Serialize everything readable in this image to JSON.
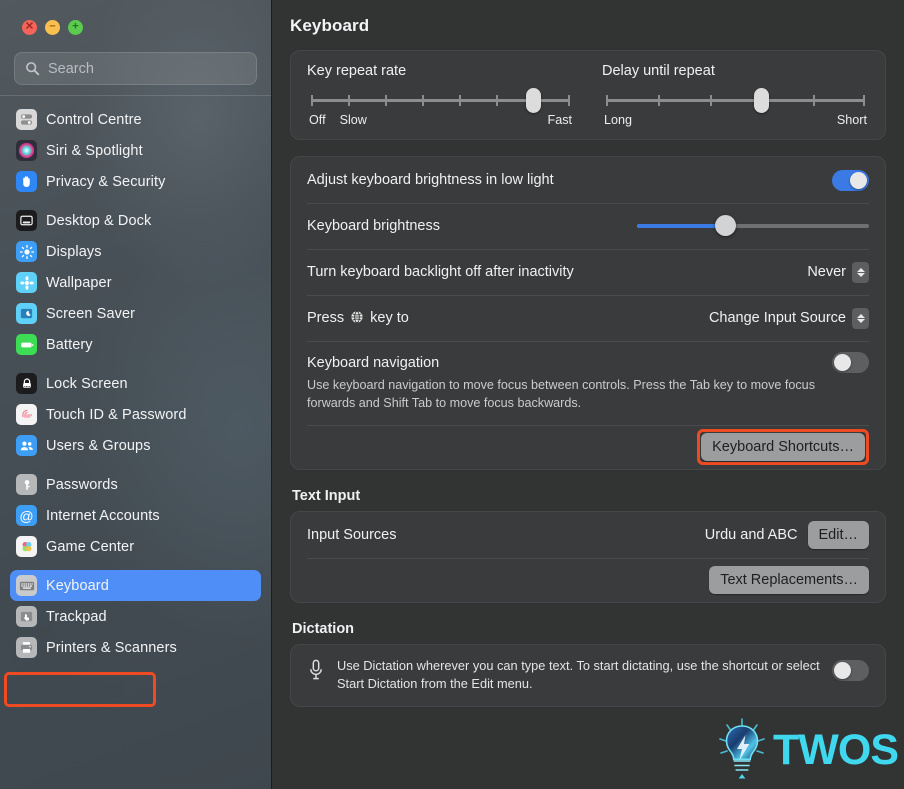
{
  "window": {
    "traffic_lights": [
      {
        "name": "close",
        "glyph": "×",
        "color": "#f4645b"
      },
      {
        "name": "minimize",
        "glyph": "−",
        "color": "#f9bf4f"
      },
      {
        "name": "maximize",
        "glyph": "+",
        "color": "#5cc94f"
      }
    ]
  },
  "sidebar": {
    "search": {
      "placeholder": "Search",
      "value": "",
      "icon": "search-icon"
    },
    "groups": [
      {
        "items": [
          {
            "label": "Control Centre",
            "icon": "control-centre-icon",
            "icon_bg": "#d8d8d8",
            "selected": false
          },
          {
            "label": "Siri & Spotlight",
            "icon": "siri-icon",
            "icon_bg": "#2f2f3a",
            "selected": false
          },
          {
            "label": "Privacy & Security",
            "icon": "privacy-hand-icon",
            "icon_bg": "#2f86f5",
            "selected": false
          }
        ]
      },
      {
        "items": [
          {
            "label": "Desktop & Dock",
            "icon": "desktop-dock-icon",
            "icon_bg": "#1c1c1e",
            "selected": false
          },
          {
            "label": "Displays",
            "icon": "displays-icon",
            "icon_bg": "#3d9ef5",
            "selected": false
          },
          {
            "label": "Wallpaper",
            "icon": "wallpaper-icon",
            "icon_bg": "#5fd0f7",
            "selected": false
          },
          {
            "label": "Screen Saver",
            "icon": "screen-saver-icon",
            "icon_bg": "#5fd0f7",
            "selected": false
          },
          {
            "label": "Battery",
            "icon": "battery-icon",
            "icon_bg": "#3ddc54",
            "selected": false
          }
        ]
      },
      {
        "items": [
          {
            "label": "Lock Screen",
            "icon": "lock-screen-icon",
            "icon_bg": "#1c1c1e",
            "selected": false
          },
          {
            "label": "Touch ID & Password",
            "icon": "touch-id-icon",
            "icon_bg": "#f4f4f4",
            "selected": false
          },
          {
            "label": "Users & Groups",
            "icon": "users-groups-icon",
            "icon_bg": "#3d9ef5",
            "selected": false
          }
        ]
      },
      {
        "items": [
          {
            "label": "Passwords",
            "icon": "passwords-key-icon",
            "icon_bg": "#b6b7b8",
            "selected": false
          },
          {
            "label": "Internet Accounts",
            "icon": "internet-accounts-icon",
            "icon_bg": "#3d9ef5",
            "selected": false
          },
          {
            "label": "Game Center",
            "icon": "game-center-icon",
            "icon_bg": "#f4f4f4",
            "selected": false
          }
        ]
      },
      {
        "items": [
          {
            "label": "Keyboard",
            "icon": "keyboard-icon",
            "icon_bg": "#c9cacb",
            "selected": true
          },
          {
            "label": "Trackpad",
            "icon": "trackpad-icon",
            "icon_bg": "#b6b7b8",
            "selected": false
          },
          {
            "label": "Printers & Scanners",
            "icon": "printers-scanners-icon",
            "icon_bg": "#b6b7b8",
            "selected": false
          }
        ]
      }
    ]
  },
  "main": {
    "page_title": "Keyboard",
    "repeat_card": {
      "key_repeat": {
        "title": "Key repeat rate",
        "ticks": 8,
        "knob_index": 7,
        "label_off": "Off",
        "label_slow": "Slow",
        "label_fast": "Fast"
      },
      "delay_repeat": {
        "title": "Delay until repeat",
        "ticks": 6,
        "knob_index": 4,
        "label_long": "Long",
        "label_short": "Short"
      }
    },
    "brightness_card": {
      "adjust_low_light": {
        "label": "Adjust keyboard brightness in low light",
        "enabled": true
      },
      "brightness": {
        "label": "Keyboard brightness",
        "value_percent": 38
      },
      "backlight_off": {
        "label": "Turn keyboard backlight off after inactivity",
        "value": "Never"
      },
      "globe_key": {
        "label_before": "Press",
        "label_after": "key to",
        "icon": "globe-icon",
        "value": "Change Input Source"
      },
      "keyboard_navigation": {
        "label": "Keyboard navigation",
        "enabled": false,
        "description": "Use keyboard navigation to move focus between controls. Press the Tab key to move focus forwards and Shift Tab to move focus backwards."
      },
      "shortcuts_button": {
        "label": "Keyboard Shortcuts…",
        "highlighted": true,
        "highlight_color": "#f04a23"
      }
    },
    "text_input": {
      "section_title": "Text Input",
      "input_sources": {
        "label": "Input Sources",
        "value": "Urdu and ABC",
        "edit_button": "Edit…"
      },
      "text_replacements_button": "Text Replacements…"
    },
    "dictation": {
      "section_title": "Dictation",
      "description": "Use Dictation wherever you can type text. To start dictating, use the shortcut or select Start Dictation from the Edit menu.",
      "enabled": false,
      "icon": "microphone-icon"
    }
  },
  "watermark": {
    "text": "TWOS",
    "icon": "lightbulb-icon",
    "color": "#3fd8ee"
  }
}
